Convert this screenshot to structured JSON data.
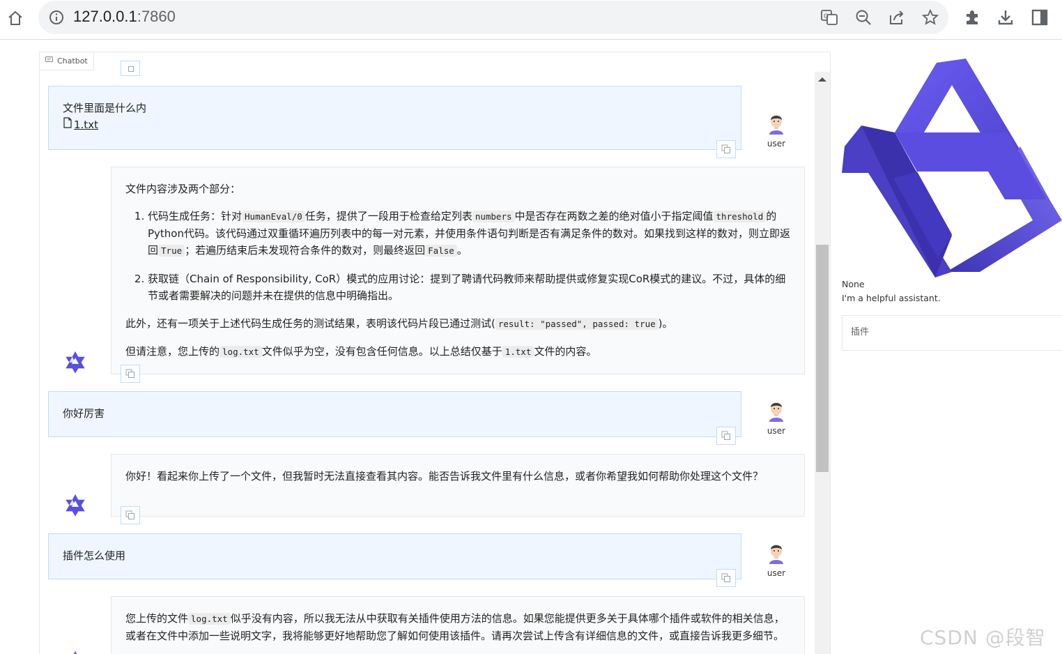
{
  "browser": {
    "url_host": "127.0.0.1",
    "url_port": ":7860"
  },
  "chat": {
    "label": "Chatbot",
    "user_name": "user",
    "messages": [
      {
        "role": "user",
        "text": "文件里面是什么内",
        "file": "1.txt"
      },
      {
        "role": "bot",
        "intro": "文件内容涉及两个部分：",
        "item1_a": "代码生成任务：针对",
        "item1_code1": "HumanEval/0",
        "item1_b": "任务，提供了一段用于检查给定列表",
        "item1_code2": "numbers",
        "item1_c": "中是否存在两数之差的绝对值小于指定阈值",
        "item1_code3": "threshold",
        "item1_d": "的Python代码。该代码通过双重循环遍历列表中的每一对元素，并使用条件语句判断是否有满足条件的数对。如果找到这样的数对，则立即返回",
        "item1_code4": "True",
        "item1_e": "；若遍历结束后未发现符合条件的数对，则最终返回",
        "item1_code5": "False",
        "item1_f": "。",
        "item2": "获取链（Chain of Responsibility, CoR）模式的应用讨论：提到了聘请代码教师来帮助提供或修复实现CoR模式的建议。不过，具体的细节或者需要解决的问题并未在提供的信息中明确指出。",
        "p2_a": "此外，还有一项关于上述代码生成任务的测试结果，表明该代码片段已通过测试(",
        "p2_code": "result: \"passed\", passed: true",
        "p2_b": ")。",
        "p3_a": "但请注意，您上传的",
        "p3_code1": "log.txt",
        "p3_b": "文件似乎为空，没有包含任何信息。以上总结仅基于",
        "p3_code2": "1.txt",
        "p3_c": "文件的内容。"
      },
      {
        "role": "user",
        "text": "你好厉害"
      },
      {
        "role": "bot",
        "text": "你好！看起来你上传了一个文件，但我暂时无法直接查看其内容。能否告诉我文件里有什么信息，或者你希望我如何帮助你处理这个文件？"
      },
      {
        "role": "user",
        "text": "插件怎么使用"
      },
      {
        "role": "bot",
        "a": "您上传的文件",
        "code": "log.txt",
        "b": "似乎没有内容，所以我无法从中获取有关插件使用方法的信息。如果您能提供更多关于具体哪个插件或软件的相关信息，或者在文件中添加一些说明文字，我将能够更好地帮助您了解如何使用该插件。请再次尝试上传含有详细信息的文件，或直接告诉我更多细节。"
      }
    ]
  },
  "sidebar": {
    "none_text": "None",
    "system_prompt": "I'm a helpful assistant.",
    "plugin_label": "插件"
  },
  "watermark": "CSDN @段智华",
  "colors": {
    "user_bg": "#eff6ff",
    "user_border": "#bfdbfe",
    "bot_bg": "#f9fafb",
    "logo_purple": "#5b4ee0"
  }
}
